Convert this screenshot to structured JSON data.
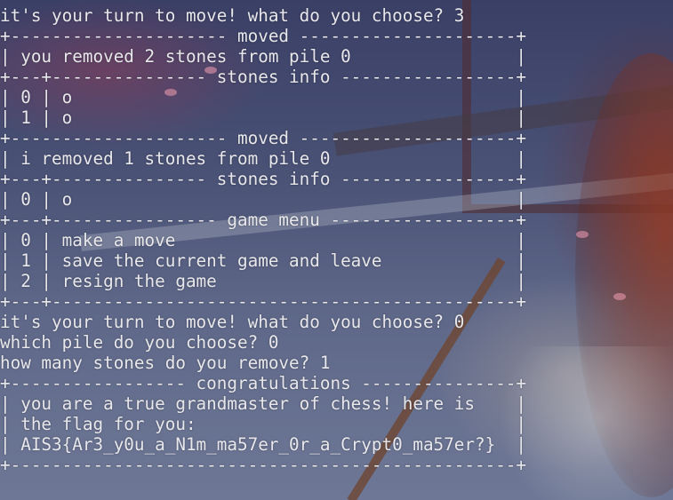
{
  "terminal": {
    "lines": [
      "it's your turn to move! what do you choose? 3",
      "+--------------------- moved ---------------------+",
      "| you removed 2 stones from pile 0                |",
      "+---+--------------- stones info -----------------+",
      "| 0 | o                                           |",
      "| 1 | o                                           |",
      "+--------------------- moved ---------------------+",
      "| i removed 1 stones from pile 0                  |",
      "+---+--------------- stones info -----------------+",
      "| 0 | o                                           |",
      "+---+---------------- game menu ------------------+",
      "| 0 | make a move                                 |",
      "| 1 | save the current game and leave             |",
      "| 2 | resign the game                             |",
      "+---+---------------------------------------------+",
      "it's your turn to move! what do you choose? 0",
      "which pile do you choose? 0",
      "how many stones do you remove? 1",
      "+----------------- congratulations ---------------+",
      "| you are a true grandmaster of chess! here is    |",
      "| the flag for you:                               |",
      "| AIS3{Ar3_y0u_a_N1m_ma57er_0r_a_Crypt0_ma57er?}  |",
      "+-------------------------------------------------+"
    ]
  }
}
